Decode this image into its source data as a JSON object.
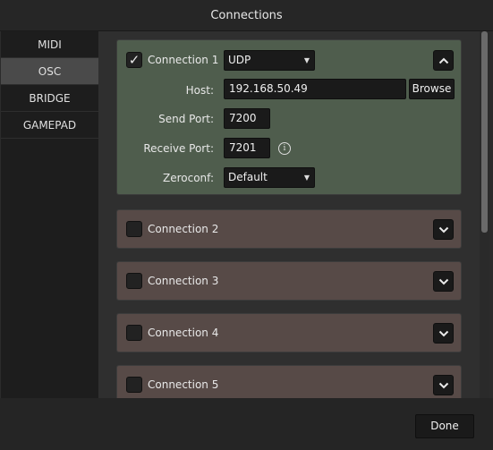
{
  "window": {
    "title": "Connections"
  },
  "sidebar": {
    "items": [
      {
        "label": "MIDI",
        "active": false
      },
      {
        "label": "OSC",
        "active": true
      },
      {
        "label": "BRIDGE",
        "active": false
      },
      {
        "label": "GAMEPAD",
        "active": false
      }
    ]
  },
  "connections": [
    {
      "label": "Connection 1",
      "enabled": true,
      "expanded": true,
      "protocol": "UDP",
      "host_label": "Host:",
      "host": "192.168.50.49",
      "browse_label": "Browse",
      "send_port_label": "Send Port:",
      "send_port": "7200",
      "receive_port_label": "Receive Port:",
      "receive_port": "7201",
      "info_icon": "info-icon",
      "zeroconf_label": "Zeroconf:",
      "zeroconf": "Default"
    },
    {
      "label": "Connection 2",
      "enabled": false,
      "expanded": false
    },
    {
      "label": "Connection 3",
      "enabled": false,
      "expanded": false
    },
    {
      "label": "Connection 4",
      "enabled": false,
      "expanded": false
    },
    {
      "label": "Connection 5",
      "enabled": false,
      "expanded": false
    }
  ],
  "footer": {
    "done_label": "Done"
  },
  "colors": {
    "expanded_panel": "#4f5d4d",
    "collapsed_panel": "#574a47",
    "active_tab": "#4a4a4a"
  }
}
